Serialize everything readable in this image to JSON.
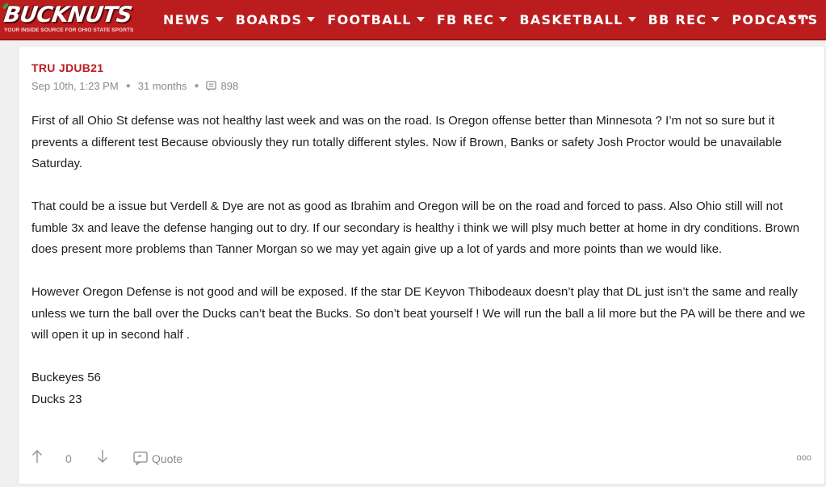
{
  "site": {
    "logo_text": "BUCKNUTS",
    "tagline": "YOUR INSIDE SOURCE FOR OHIO STATE SPORTS",
    "brand_color": "#bb1d1f"
  },
  "nav": {
    "items": [
      {
        "label": "NEWS"
      },
      {
        "label": "BOARDS"
      },
      {
        "label": "FOOTBALL"
      },
      {
        "label": "FB REC"
      },
      {
        "label": "BASKETBALL"
      },
      {
        "label": "BB REC"
      },
      {
        "label": "PODCASTS"
      }
    ],
    "more_label": "···"
  },
  "post": {
    "author": "TRU JDUB21",
    "date": "Sep 10th, 1:23 PM",
    "age": "31 months",
    "views": "898",
    "paragraphs": [
      "First of all Ohio St defense was not healthy last week and was on the road. Is Oregon offense better than Minnesota ? I’m not so sure but it prevents a different test Because obviously they run totally different styles. Now if Brown, Banks or safety Josh Proctor would be unavailable Saturday.",
      "That could be a issue but Verdell & Dye are not as good as Ibrahim and Oregon will be on the road and forced to pass. Also Ohio still will not fumble 3x and leave the defense hanging out to dry. If our secondary is healthy i think we will plsy much better at home in dry conditions. Brown does present more problems than Tanner Morgan so we may yet again give up a lot of yards and more points than we would like.",
      "However Oregon Defense is not good and will be exposed. If the star DE Keyvon Thibodeaux doesn’t play that DL just isn’t the same and really unless we turn the ball over the Ducks can’t beat the Bucks. So don’t beat yourself ! We will run the ball a lil more but the PA will be there and we will open it up in second half ."
    ],
    "score_lines": [
      "Buckeyes 56",
      "Ducks 23"
    ],
    "vote_count": "0",
    "quote_label": "Quote",
    "more_label": "ooo"
  }
}
